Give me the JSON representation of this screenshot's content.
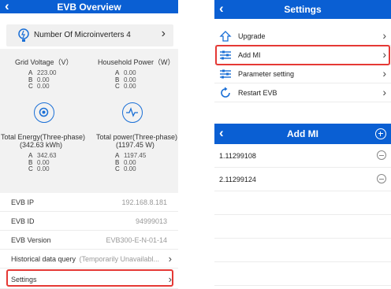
{
  "overview": {
    "title": "EVB Overview",
    "microinverters_label": "Number Of Microinverters 4",
    "grid_voltage_label": "Grid Voltage（V）",
    "household_power_label": "Household Power（W）",
    "grid_voltage": [
      {
        "k": "A",
        "v": "223.00"
      },
      {
        "k": "B",
        "v": "0.00"
      },
      {
        "k": "C",
        "v": "0.00"
      }
    ],
    "household_power": [
      {
        "k": "A",
        "v": "0.00"
      },
      {
        "k": "B",
        "v": "0.00"
      },
      {
        "k": "C",
        "v": "0.00"
      }
    ],
    "total_energy_label": "Total Energy(Three-phase)",
    "total_energy_value": "(342.63 kWh)",
    "total_power_label": "Total power(Three-phase)",
    "total_power_value": "(1197.45 W)",
    "total_energy": [
      {
        "k": "A",
        "v": "342.63"
      },
      {
        "k": "B",
        "v": "0.00"
      },
      {
        "k": "C",
        "v": "0.00"
      }
    ],
    "total_power": [
      {
        "k": "A",
        "v": "1197.45"
      },
      {
        "k": "B",
        "v": "0.00"
      },
      {
        "k": "C",
        "v": "0.00"
      }
    ],
    "info": {
      "evb_ip_label": "EVB IP",
      "evb_ip": "192.168.8.181",
      "evb_id_label": "EVB ID",
      "evb_id": "94999013",
      "evb_version_label": "EVB Version",
      "evb_version": "EVB300-E-N-01-14",
      "historical_label": "Historical data query",
      "historical_value": "(Temporarily Unavailabl...",
      "settings_label": "Settings"
    }
  },
  "settings": {
    "title": "Settings",
    "items": [
      {
        "label": "Upgrade",
        "icon": "upgrade-icon"
      },
      {
        "label": "Add MI",
        "icon": "sliders-icon"
      },
      {
        "label": "Parameter setting",
        "icon": "sliders-icon"
      },
      {
        "label": "Restart EVB",
        "icon": "restart-icon"
      }
    ]
  },
  "add_mi": {
    "title": "Add MI",
    "items": [
      "1.11299108",
      "2.11299124"
    ]
  },
  "colors": {
    "accent": "#0a5fd3",
    "highlight": "#e53935"
  }
}
